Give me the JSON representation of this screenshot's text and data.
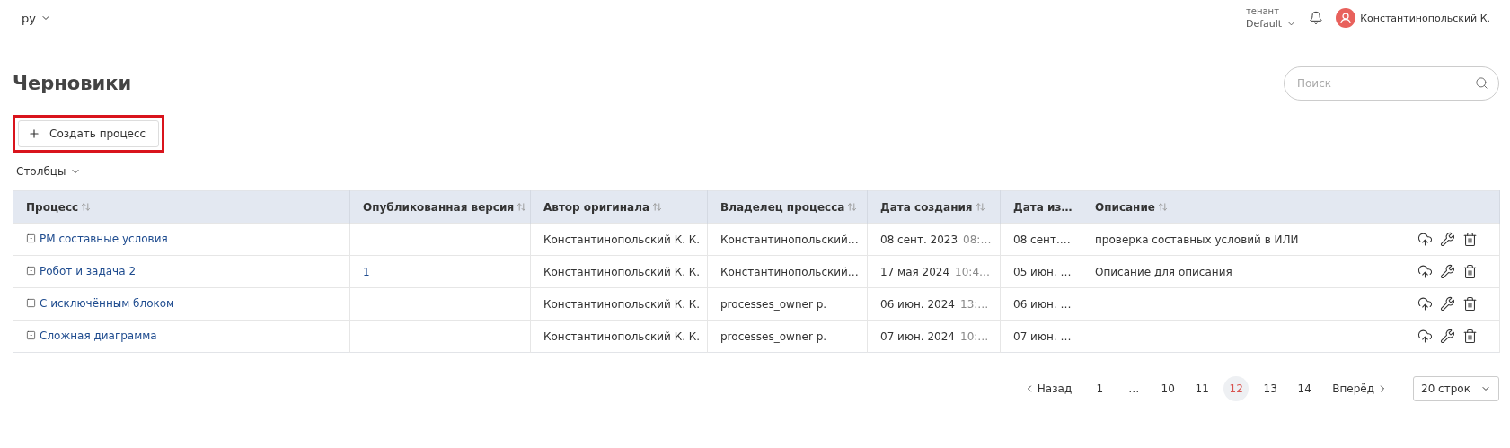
{
  "language": {
    "label": "ру"
  },
  "tenant": {
    "caption": "тенант",
    "value": "Default"
  },
  "user": {
    "name": "Константинопольский К."
  },
  "page_title": "Черновики",
  "search": {
    "placeholder": "Поиск"
  },
  "create_button": {
    "label": "Создать процесс",
    "highlighted": true
  },
  "columns_menu": {
    "label": "Столбцы"
  },
  "table": {
    "columns": [
      {
        "label": "Процесс",
        "sortable": true
      },
      {
        "label": "Опубликованная версия",
        "sortable": true
      },
      {
        "label": "Автор оригинала",
        "sortable": true
      },
      {
        "label": "Владелец процесса",
        "sortable": true
      },
      {
        "label": "Дата создания",
        "sortable": true
      },
      {
        "label": "Дата из…",
        "sortable": false
      },
      {
        "label": "Описание",
        "sortable": true
      }
    ],
    "rows": [
      {
        "process": "РМ составные условия",
        "version": "",
        "author": "Константинопольский К. К.",
        "owner": "Константинопольский…",
        "created_date": "08 сент. 2023",
        "created_time": "08:…",
        "modified": "08 сент.…",
        "description": "проверка составных условий в ИЛИ"
      },
      {
        "process": "Робот и задача 2",
        "version": "1",
        "author": "Константинопольский К. К.",
        "owner": "Константинопольский…",
        "created_date": "17 мая 2024",
        "created_time": "10:4…",
        "modified": "05 июн. …",
        "description": "Описание для описания"
      },
      {
        "process": "С исключённым блоком",
        "version": "",
        "author": "Константинопольский К. К.",
        "owner": "processes_owner p.",
        "created_date": "06 июн. 2024",
        "created_time": "13:…",
        "modified": "06 июн. …",
        "description": ""
      },
      {
        "process": "Сложная диаграмма",
        "version": "",
        "author": "Константинопольский К. К.",
        "owner": "processes_owner p.",
        "created_date": "07 июн. 2024",
        "created_time": "10:…",
        "modified": "07 июн. …",
        "description": ""
      }
    ]
  },
  "pagination": {
    "prev": "Назад",
    "next": "Вперёд",
    "pages": [
      {
        "label": "1",
        "selected": false
      },
      {
        "label": "…",
        "selected": false
      },
      {
        "label": "10",
        "selected": false
      },
      {
        "label": "11",
        "selected": false
      },
      {
        "label": "12",
        "selected": true
      },
      {
        "label": "13",
        "selected": false
      },
      {
        "label": "14",
        "selected": false
      }
    ],
    "page_size": "20 строк"
  }
}
